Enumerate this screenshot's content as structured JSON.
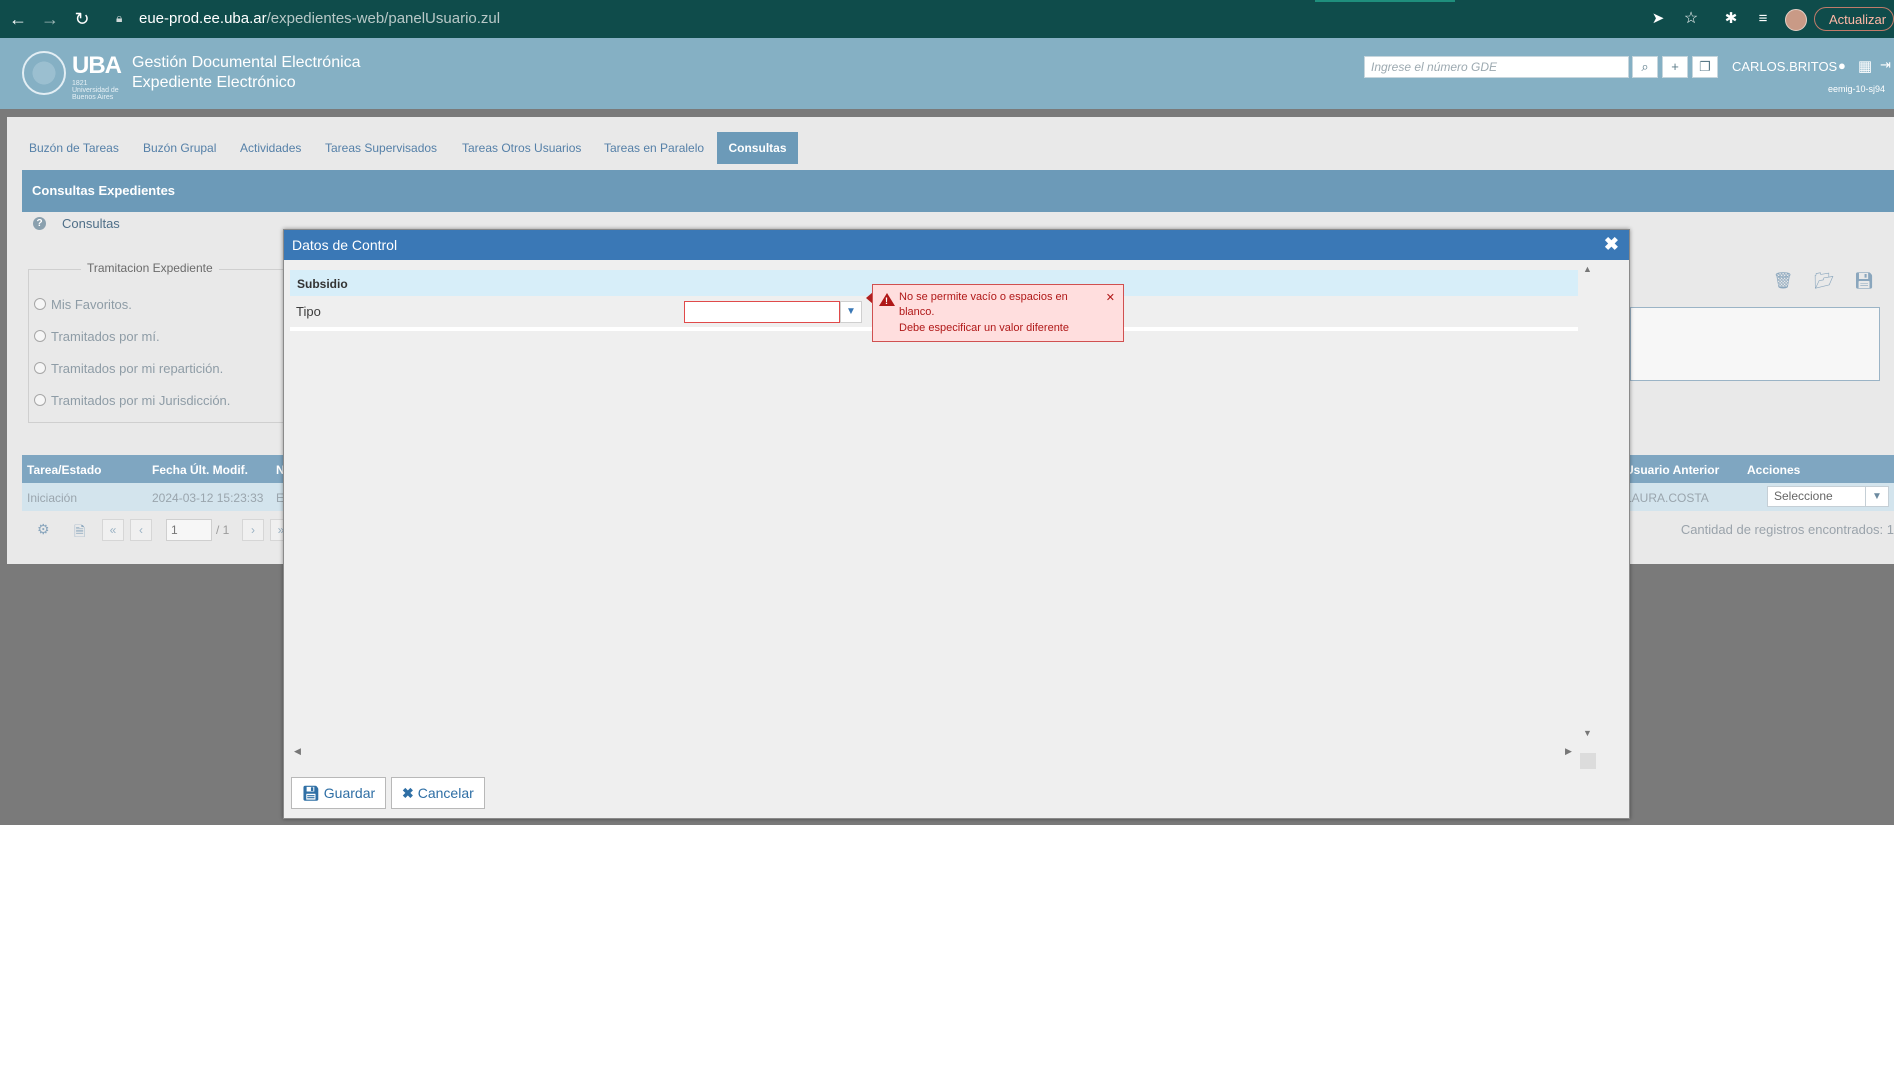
{
  "browser": {
    "url_host": "eue-prod.ee.uba.ar",
    "url_path": "/expedientes-web/panelUsuario.zul",
    "update_label": "Actualizar"
  },
  "header": {
    "logo_text": "UBA",
    "logo_sub": "1821 Universidad de Buenos Aires",
    "title_line1": "Gestión Documental Electrónica",
    "title_line2": "Expediente Electrónico",
    "search_placeholder": "Ingrese el número GDE",
    "user": "CARLOS.BRITOS",
    "server": "eemig-10-sj94"
  },
  "tabs": [
    {
      "label": "Buzón de Tareas"
    },
    {
      "label": "Buzón Grupal"
    },
    {
      "label": "Actividades"
    },
    {
      "label": "Tareas Supervisados"
    },
    {
      "label": "Tareas Otros Usuarios"
    },
    {
      "label": "Tareas en Paralelo"
    },
    {
      "label": "Consultas",
      "active": true
    }
  ],
  "section": {
    "title": "Consultas Expedientes",
    "sub": "Consultas"
  },
  "tramitacion": {
    "legend": "Tramitacion Expediente",
    "options": [
      "Mis Favoritos.",
      "Tramitados por mí.",
      "Tramitados por mi repartición.",
      "Tramitados por mi Jurisdicción."
    ]
  },
  "grid": {
    "headers": {
      "tarea": "Tarea/Estado",
      "fecha": "Fecha Últ. Modif.",
      "n": "N",
      "usuario_anterior": "Usuario Anterior",
      "acciones": "Acciones"
    },
    "row": {
      "tarea": "Iniciación",
      "fecha": "2024-03-12 15:23:33",
      "n": "E",
      "usuario_anterior": "LAURA.COSTA",
      "accion": "Seleccione"
    },
    "pager": {
      "page": "1",
      "total": "/ 1"
    },
    "record_count": "Cantidad de registros encontrados: 1"
  },
  "modal": {
    "title": "Datos de Control",
    "subsidio_label": "Subsidio",
    "tipo_label": "Tipo",
    "tipo_value": "",
    "save_label": "Guardar",
    "cancel_label": "Cancelar"
  },
  "error": {
    "line1": "No se permite vacío o espacios en blanco.",
    "line2": "Debe especificar un valor diferente"
  },
  "colors": {
    "chrome": "#0f4c4b",
    "header": "#85b0c4",
    "modal_title": "#3a78b6",
    "error": "#b01818"
  }
}
